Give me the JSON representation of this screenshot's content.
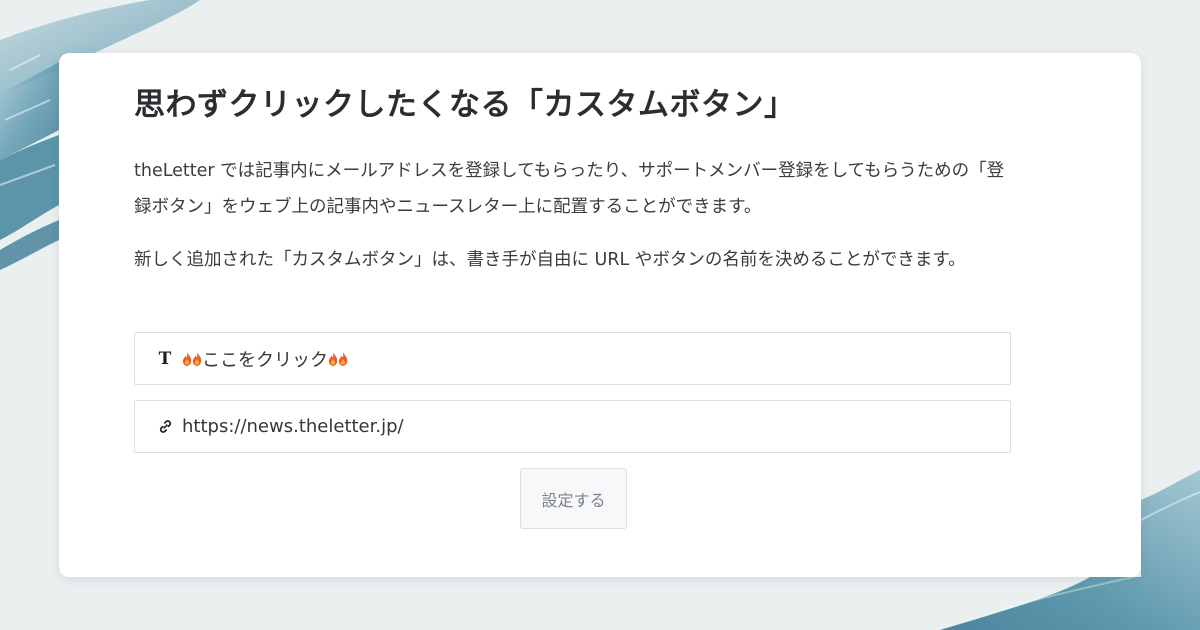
{
  "card": {
    "title": "思わずクリックしたくなる「カスタムボタン」",
    "paragraph_1": "theLetter では記事内にメールアドレスを登録してもらったり、サポートメンバー登録をしてもらうための「登録ボタン」をウェブ上の記事内やニュースレター上に配置することができます。",
    "paragraph_2": "新しく追加された「カスタムボタン」は、書き手が自由に URL やボタンの名前を決めることができます。"
  },
  "button_text_field": {
    "icon": "text-format-icon",
    "icon_glyph": "T",
    "decoration_icon": "fire-icon",
    "value": "ここをクリック"
  },
  "button_url_field": {
    "icon": "link-icon",
    "value": "https://news.theletter.jp/"
  },
  "submit_button": {
    "label": "設定する"
  },
  "colors": {
    "background": "#eaeff0",
    "card": "#ffffff",
    "brush_stroke": "#4f8fa6",
    "text": "#2d2f33"
  }
}
